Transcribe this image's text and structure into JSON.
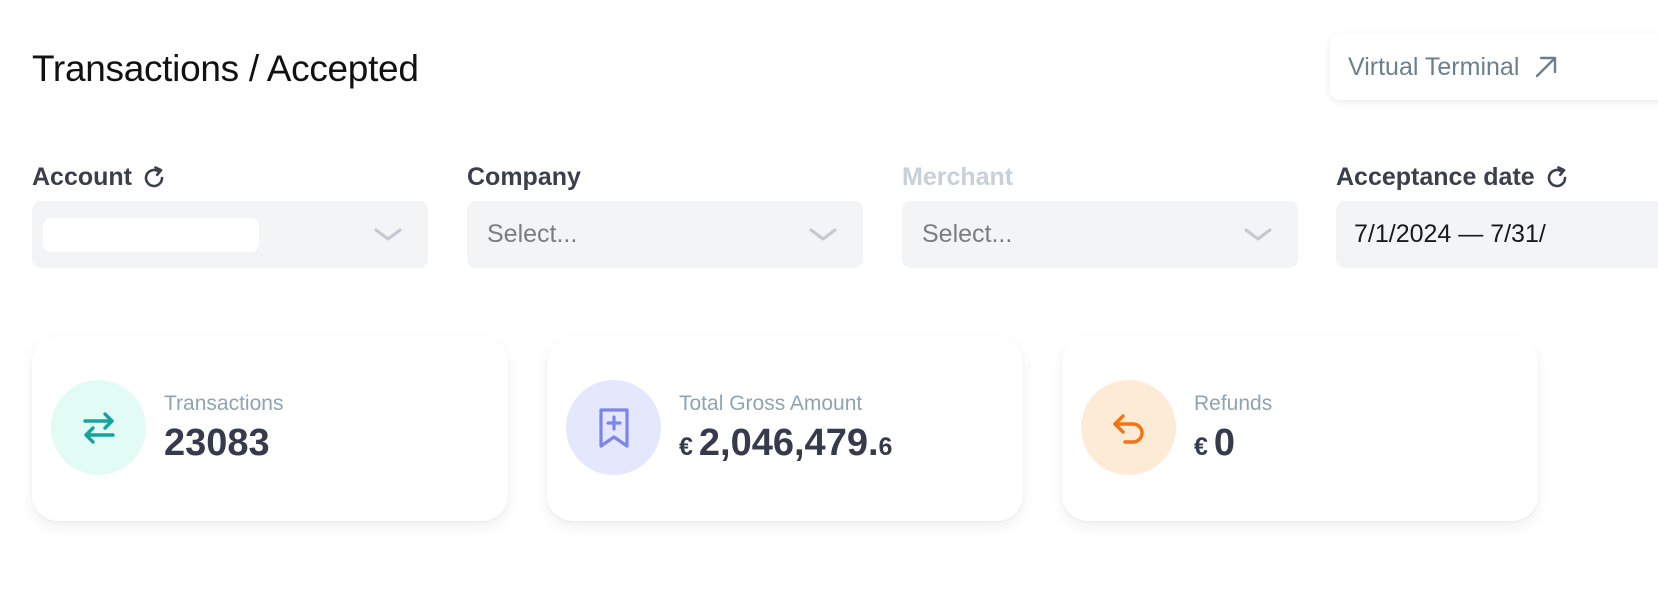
{
  "header": {
    "title": "Transactions / Accepted",
    "virtual_terminal_label": "Virtual Terminal"
  },
  "filters": {
    "account": {
      "label": "Account",
      "value": ""
    },
    "company": {
      "label": "Company",
      "placeholder": "Select..."
    },
    "merchant": {
      "label": "Merchant",
      "placeholder": "Select..."
    },
    "acceptance_date": {
      "label": "Acceptance date",
      "value": "7/1/2024 — 7/31/"
    }
  },
  "cards": [
    {
      "label": "Transactions",
      "value": "23083",
      "icon": "transfer-arrows-icon",
      "icon_bg": "#e3fbf5",
      "icon_color": "#14a3a0"
    },
    {
      "label": "Total Gross Amount",
      "currency": "€",
      "value": "2,046,479.",
      "decimal": "6",
      "icon": "bookmark-plus-icon",
      "icon_bg": "#e5e8fd",
      "icon_color": "#7b86ec"
    },
    {
      "label": "Refunds",
      "currency": "€",
      "value": "0",
      "icon": "undo-arrow-icon",
      "icon_bg": "#fdebd5",
      "icon_color": "#f27414"
    }
  ]
}
